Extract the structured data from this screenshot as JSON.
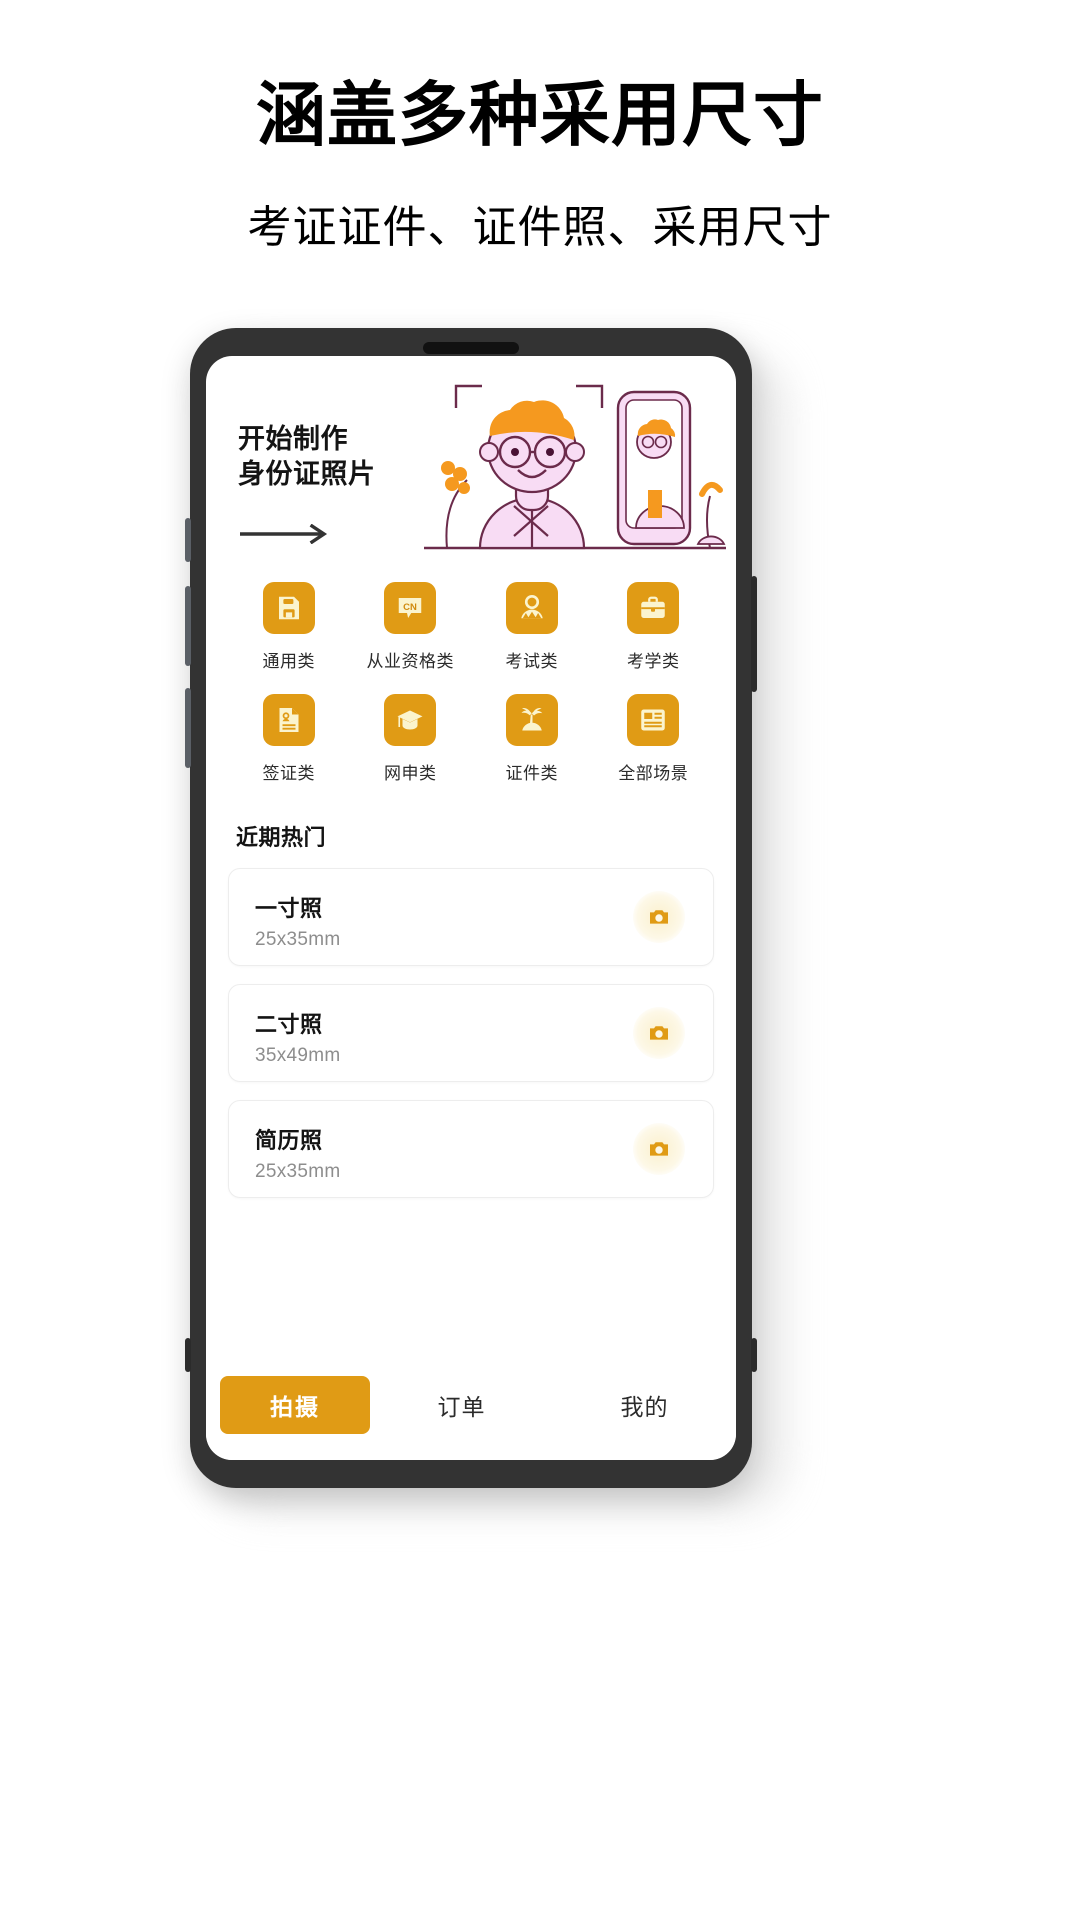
{
  "promo": {
    "headline": "涵盖多种采用尺寸",
    "subheadline": "考证证件、证件照、采用尺寸"
  },
  "app": {
    "banner": {
      "line1": "开始制作",
      "line2": "身份证照片",
      "arrow_icon": "arrow-right-icon",
      "art_icon": "id-photo-illustration"
    },
    "categories": [
      {
        "label": "通用类",
        "icon": "floppy-disk-icon"
      },
      {
        "label": "从业资格类",
        "icon": "cn-speech-bubble-icon"
      },
      {
        "label": "考试类",
        "icon": "person-icon"
      },
      {
        "label": "考学类",
        "icon": "briefcase-icon"
      },
      {
        "label": "签证类",
        "icon": "id-document-icon"
      },
      {
        "label": "网申类",
        "icon": "graduation-cap-icon"
      },
      {
        "label": "证件类",
        "icon": "palm-tree-icon"
      },
      {
        "label": "全部场景",
        "icon": "grid-layout-icon"
      }
    ],
    "section": {
      "title": "近期热门"
    },
    "hot_items": [
      {
        "title": "一寸照",
        "size": "25x35mm",
        "action_icon": "camera-icon"
      },
      {
        "title": "二寸照",
        "size": "35x49mm",
        "action_icon": "camera-icon"
      },
      {
        "title": "简历照",
        "size": "25x35mm",
        "action_icon": "camera-icon"
      }
    ],
    "nav": {
      "primary": "拍摄",
      "items": [
        "订单",
        "我的"
      ]
    }
  },
  "colors": {
    "accent": "#E09B15",
    "tile_icon": "#FBF4CE",
    "art_orange": "#F5991F",
    "art_pink": "#F8DCF4",
    "art_outline": "#6B2B4B"
  }
}
